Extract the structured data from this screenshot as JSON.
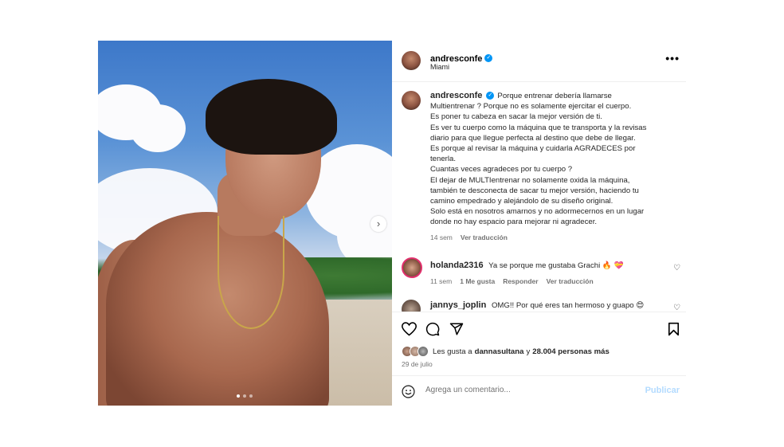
{
  "post": {
    "username": "andresconfe",
    "location": "Miami",
    "more_label": "•••",
    "carousel_next": "›"
  },
  "caption": {
    "username": "andresconfe",
    "lines": [
      "Porque entrenar debería llamarse",
      "Multientrenar ? Porque no es solamente ejercitar el cuerpo.",
      "Es poner tu cabeza en sacar la mejor versión de ti.",
      "Es ver tu cuerpo como la máquina que te transporta y la revisas",
      "diario para que llegue perfecta al destino que debe de llegar.",
      "Es porque al revisar la máquina y cuidarla AGRADECES por",
      "tenerla.",
      "Cuantas veces agradeces por tu cuerpo ?",
      "El dejar de MULTIentrenar no solamente oxida la máquina,",
      "también te desconecta de sacar tu mejor versión, haciendo tu",
      "camino empedrado y alejándolo de su diseño original.",
      "Solo está en nosotros amarnos y no adormecernos en un lugar",
      "donde no hay espacio para mejorar ni agradecer."
    ],
    "time": "14 sem",
    "translate": "Ver traducción"
  },
  "comments": [
    {
      "username": "holanda2316",
      "text": "Ya se porque me gustaba Grachi",
      "emojis": "🔥 💝",
      "time": "11 sem",
      "likes": "1 Me gusta",
      "reply": "Responder",
      "translate": "Ver traducción"
    },
    {
      "username": "jannys_joplin",
      "text": "OMG!! Por qué eres tan hermoso y guapo",
      "emojis": "😍"
    }
  ],
  "likes": {
    "prefix": "Les gusta a",
    "user": "dannasultana",
    "middle": "y",
    "count": "28.004 personas más"
  },
  "date": "29 de julio",
  "add_comment": {
    "placeholder": "Agrega un comentario...",
    "publish": "Publicar"
  },
  "colors": {
    "verified": "#0095f6",
    "publish_disabled": "#b3dbff",
    "muted": "#737373"
  }
}
